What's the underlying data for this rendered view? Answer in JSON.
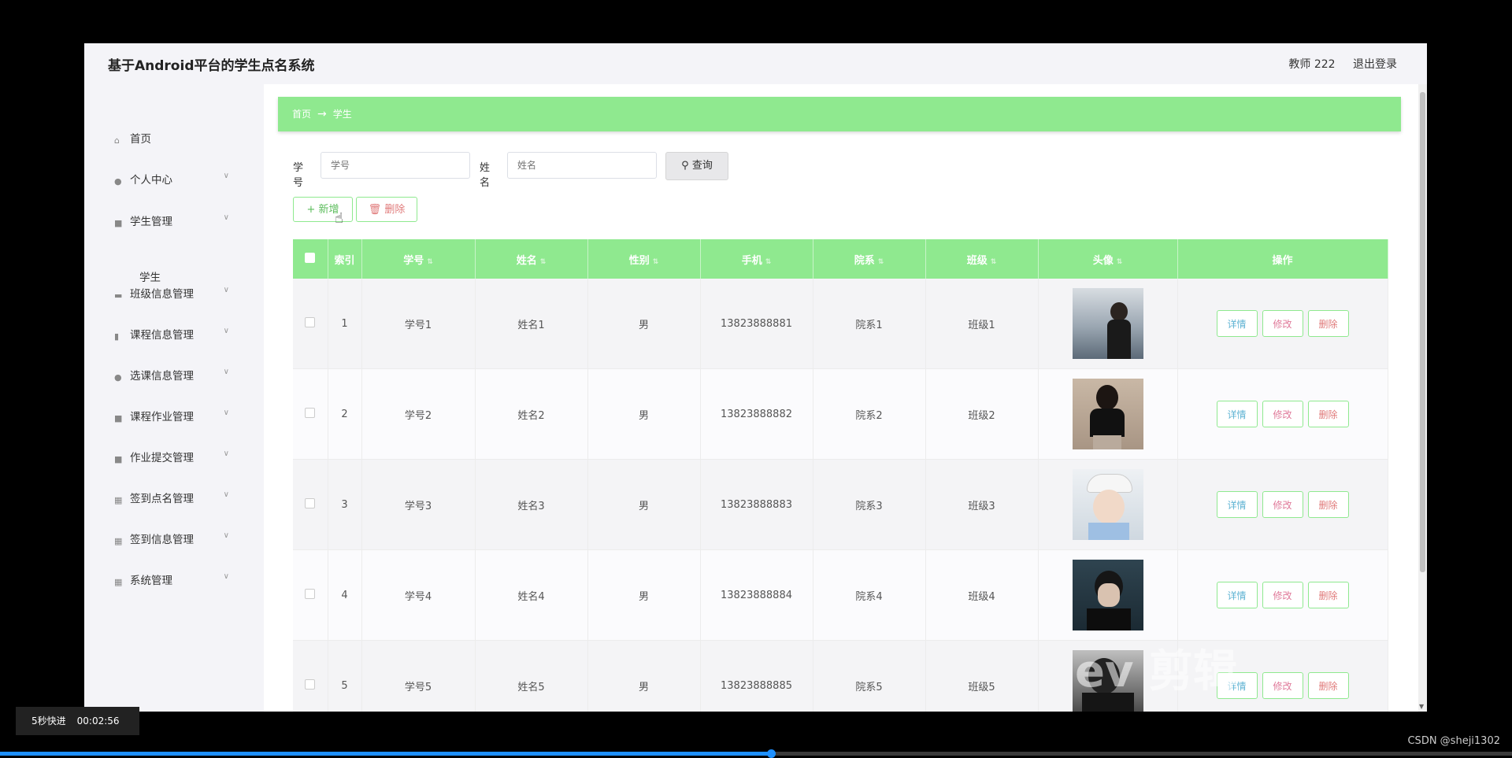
{
  "app": {
    "title": "基于Android平台的学生点名系统",
    "user_label": "教师 222",
    "logout_label": "退出登录"
  },
  "sidebar": {
    "items": [
      {
        "label": "首页",
        "icon": "home-icon",
        "chevron": false
      },
      {
        "label": "个人中心",
        "icon": "user-icon",
        "chevron": true
      },
      {
        "label": "学生管理",
        "icon": "clipboard-icon",
        "chevron": true
      },
      {
        "label": "班级信息管理",
        "icon": "monitor-icon",
        "chevron": true
      },
      {
        "label": "课程信息管理",
        "icon": "bar-chart-icon",
        "chevron": true
      },
      {
        "label": "选课信息管理",
        "icon": "user-icon",
        "chevron": true
      },
      {
        "label": "课程作业管理",
        "icon": "clipboard-icon",
        "chevron": true
      },
      {
        "label": "作业提交管理",
        "icon": "clipboard-icon",
        "chevron": true
      },
      {
        "label": "签到点名管理",
        "icon": "grid-icon",
        "chevron": true
      },
      {
        "label": "签到信息管理",
        "icon": "grid-icon",
        "chevron": true
      },
      {
        "label": "系统管理",
        "icon": "grid-icon",
        "chevron": true
      }
    ],
    "sub_item": "学生"
  },
  "breadcrumb": {
    "home": "首页",
    "arrow": "→",
    "current": "学生"
  },
  "search": {
    "student_id_label": "学号",
    "student_id_placeholder": "学号",
    "name_label": "姓名",
    "name_placeholder": "姓名",
    "query_label": "查询"
  },
  "actions": {
    "add_label": "新增",
    "delete_label": "删除"
  },
  "table": {
    "headers": [
      "索引",
      "学号",
      "姓名",
      "性别",
      "手机",
      "院系",
      "班级",
      "头像",
      "操作"
    ],
    "rows": [
      {
        "index": "1",
        "sid": "学号1",
        "name": "姓名1",
        "gender": "男",
        "phone": "13823888881",
        "dept": "院系1",
        "class": "班级1"
      },
      {
        "index": "2",
        "sid": "学号2",
        "name": "姓名2",
        "gender": "男",
        "phone": "13823888882",
        "dept": "院系2",
        "class": "班级2"
      },
      {
        "index": "3",
        "sid": "学号3",
        "name": "姓名3",
        "gender": "男",
        "phone": "13823888883",
        "dept": "院系3",
        "class": "班级3"
      },
      {
        "index": "4",
        "sid": "学号4",
        "name": "姓名4",
        "gender": "男",
        "phone": "13823888884",
        "dept": "院系4",
        "class": "班级4"
      },
      {
        "index": "5",
        "sid": "学号5",
        "name": "姓名5",
        "gender": "男",
        "phone": "13823888885",
        "dept": "院系5",
        "class": "班级5"
      }
    ],
    "op_detail": "详情",
    "op_edit": "修改",
    "op_delete": "删除"
  },
  "player": {
    "speed_label": "5秒快进",
    "time": "00:02:56",
    "progress": 0.51,
    "watermark": "ev 剪辑",
    "csdn": "CSDN @sheji1302"
  },
  "colors": {
    "accent": "#8fe98f",
    "detail": "#5fb3d3",
    "edit": "#e07a9a",
    "delete": "#e07a7a"
  }
}
